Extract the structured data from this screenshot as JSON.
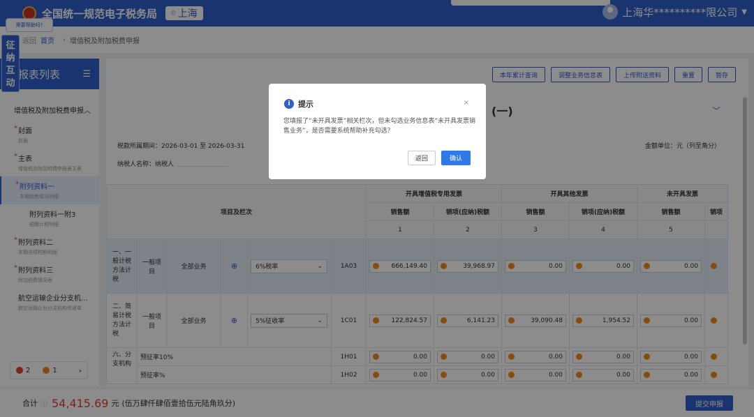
{
  "header": {
    "title": "全国统一规范电子税务局",
    "region": "上海",
    "user": "上海华**********限公司"
  },
  "help": {
    "bubble": "需要帮助吗?",
    "side_tab": "征纳互动"
  },
  "breadcrumb": {
    "back": "返回",
    "home": "首页",
    "current": "增值税及附加税费申报"
  },
  "left": {
    "title": "报表列表",
    "group": "增值税及附加税费申报",
    "items": [
      {
        "title": "封面",
        "sub": "封面",
        "required": "*"
      },
      {
        "title": "主表",
        "sub": "增值税及附加税费申报表主表",
        "required": "*"
      },
      {
        "title": "附列资料一",
        "sub": "本期销售情况明细",
        "required": "*"
      },
      {
        "title": "附列资料一附3",
        "sub": "预缴计税明细"
      },
      {
        "title": "附列资料二",
        "sub": "本期进项税额明细",
        "required": "*"
      },
      {
        "title": "附列资料三",
        "sub": "附加税费情况表",
        "required": "*"
      },
      {
        "title": "航空运输企业分支机...",
        "sub": "航空运输企业分支机构传递单"
      }
    ],
    "errors": "2",
    "warnings": "1"
  },
  "toolbar": [
    "本年累计查询",
    "调整业务信息表",
    "上传附送资料",
    "重置",
    "暂存"
  ],
  "form": {
    "title_tail": "(一)",
    "period": "税款所属期间：2026-03-01 至 2026-03-31",
    "taxpayer": "纳税人名称：纳税人",
    "unit": "金额单位：元（列至角分）"
  },
  "table": {
    "item_header": "项目及栏次",
    "groups": [
      "开具增值税专用发票",
      "开具其他发票",
      "未开具发票"
    ],
    "sub_headers": [
      "销售额",
      "销项(应纳)税额",
      "销售额",
      "销项(应纳)税额",
      "销售额",
      "销项"
    ],
    "col_nums": [
      "1",
      "2",
      "3",
      "4",
      "5"
    ],
    "rows": [
      {
        "section": "一、一般计税方法计税",
        "type": "一般项目",
        "biz": "全部业务",
        "rate": "6%税率",
        "code": "1A03",
        "vals": [
          "666,149.40",
          "39,968.97",
          "0.00",
          "0.00",
          "0.00"
        ]
      },
      {
        "section": "二、简易计税方法计税",
        "type": "一般项目",
        "biz": "全部业务",
        "rate": "5%征收率",
        "code": "1C01",
        "vals": [
          "122,824.57",
          "6,141.23",
          "39,090.48",
          "1,954.52",
          "0.00"
        ]
      },
      {
        "section": "六、分支机构",
        "type": "预征率10%",
        "code": "1H01",
        "vals": [
          "0.00",
          "0.00",
          "0.00",
          "0.00",
          "0.00"
        ]
      },
      {
        "type": "预征率%",
        "code": "1H02",
        "vals": [
          "0.00",
          "0.00",
          "0.00",
          "0.00",
          "0.00"
        ]
      }
    ]
  },
  "bottom": {
    "label": "合计",
    "value": "54,415.69",
    "unit": "元",
    "uppercase": "(伍万肆仟肆佰壹拾伍元陆角玖分)",
    "submit": "提交申报"
  },
  "dialog": {
    "title": "提示",
    "message": "您填报了“未开具发票”相关栏次，但未勾选业务信息表“未开具发票销售业务”，是否需要系统帮助补充勾选？",
    "cancel": "返回",
    "ok": "确认"
  }
}
